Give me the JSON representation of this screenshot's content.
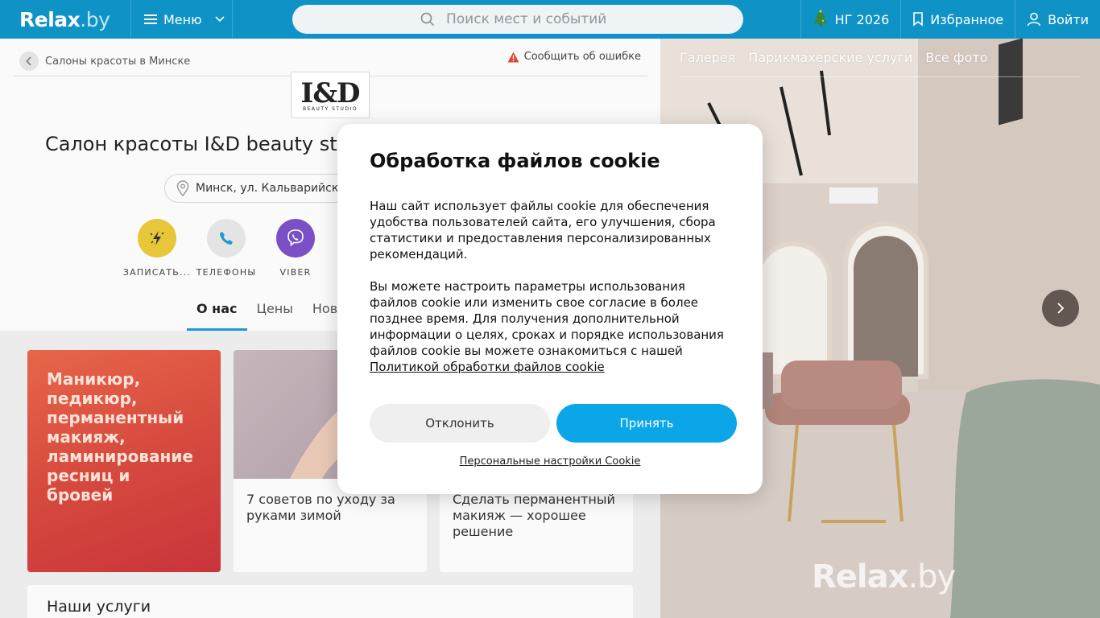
{
  "header": {
    "logo": {
      "main": "Relax",
      "suffix": ".by"
    },
    "menu_label": "Меню",
    "search_placeholder": "Поиск мест и событий",
    "ng_label": "НГ 2026",
    "favorites_label": "Избранное",
    "login_label": "Войти"
  },
  "breadcrumb": {
    "label": "Салоны красоты в Минске"
  },
  "report_label": "Сообщить об ошибке",
  "brand": {
    "main": "I&D",
    "sub": "BEAUTY STUDIO"
  },
  "salon": {
    "title": "Салон красоты I&D beauty st",
    "address": "Минск, ул. Кальварийск"
  },
  "actions": [
    {
      "label": "ЗАПИСАТЬ...",
      "icon": "flash-booking-icon",
      "color": "#e8c63a"
    },
    {
      "label": "ТЕЛЕФОНЫ",
      "icon": "phone-icon",
      "color": "#e4e4e4"
    },
    {
      "label": "VIBER",
      "icon": "viber-icon",
      "color": "#7b4fc6"
    }
  ],
  "tabs": [
    {
      "label": "О нас",
      "active": true
    },
    {
      "label": "Цены",
      "active": false
    },
    {
      "label": "Ново",
      "active": false
    }
  ],
  "promo": {
    "text": "Маникюр, педикюр, перманентный макияж, ламинирование ресниц и бровей"
  },
  "articles": [
    {
      "caption": "7 советов по уходу за руками зимой"
    },
    {
      "caption": "Сделать перманентный макияж — хорошее решение"
    }
  ],
  "services_title": "Наши услуги",
  "gallery": {
    "nav": [
      "Галерея",
      "Парикмахерские услуги",
      "Все фото"
    ],
    "watermark_main": "Relax",
    "watermark_suffix": ".by"
  },
  "cookie": {
    "title": "Обработка файлов cookie",
    "paragraph1": "Наш сайт использует файлы cookie для обеспечения удобства пользователей сайта, его улучшения, сбора статистики и предоставления персонализированных рекомендаций.",
    "paragraph2": "Вы можете настроить параметры использования файлов cookie или изменить свое согласие в более позднее время. Для получения дополнительной информации о целях, сроках и порядке использования файлов cookie вы можете ознакомиться с нашей",
    "policy_link": "Политикой обработки файлов cookie",
    "decline": "Отклонить",
    "accept": "Принять",
    "settings": "Персональные настройки Cookie"
  },
  "colors": {
    "header": "#0f93c7",
    "accept": "#0aa6e8",
    "tab_active": "#1a9ad2"
  }
}
